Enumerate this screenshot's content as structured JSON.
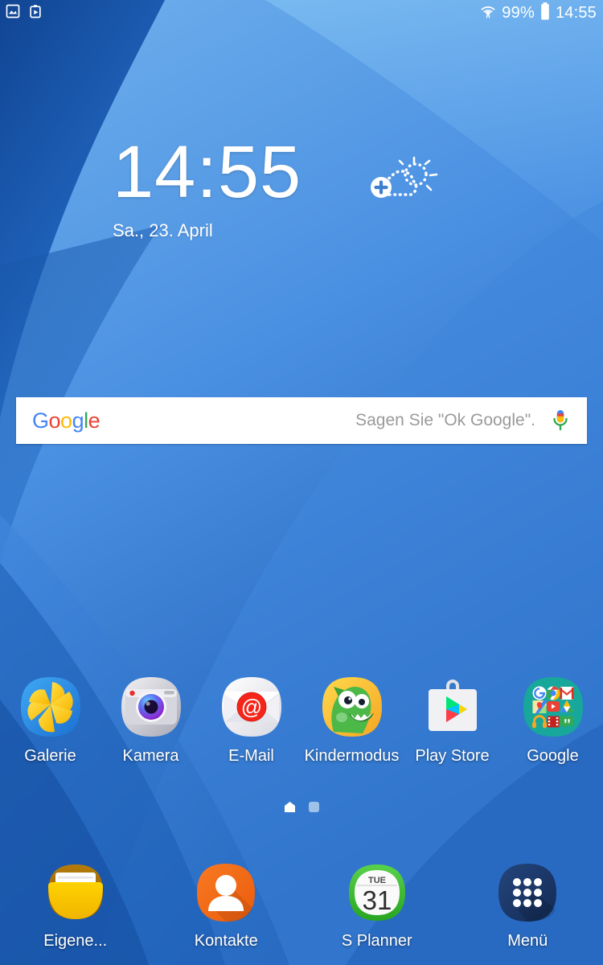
{
  "status_bar": {
    "left_icons": [
      {
        "name": "screenshot-icon",
        "label": "screenshot"
      },
      {
        "name": "media-clipboard-icon",
        "label": "smart-capture"
      }
    ],
    "wifi_icon": "wifi-icon",
    "battery_percent": "99%",
    "battery_icon": "battery-full-icon",
    "clock": "14:55"
  },
  "clock_widget": {
    "time": "14:55",
    "date": "Sa., 23. April",
    "weather_add_icon": "add-weather-icon"
  },
  "search": {
    "logo_letters": [
      "G",
      "o",
      "o",
      "g",
      "l",
      "e"
    ],
    "placeholder": "Sagen Sie \"Ok Google\".",
    "mic_icon": "microphone-icon"
  },
  "apps": [
    {
      "label": "Galerie",
      "icon": "gallery-icon"
    },
    {
      "label": "Kamera",
      "icon": "camera-icon"
    },
    {
      "label": "E-Mail",
      "icon": "email-icon"
    },
    {
      "label": "Kindermodus",
      "icon": "kids-mode-icon"
    },
    {
      "label": "Play Store",
      "icon": "play-store-icon"
    },
    {
      "label": "Google",
      "icon": "google-folder-icon"
    }
  ],
  "google_folder_apps": [
    "google-search-icon",
    "chrome-icon",
    "gmail-icon",
    "maps-icon",
    "youtube-icon",
    "drive-icon",
    "play-music-icon",
    "play-movies-icon",
    "hangouts-icon"
  ],
  "page_indicator": {
    "pages": 2,
    "current": 1,
    "home_icon": "home-page-indicator-icon"
  },
  "dock": [
    {
      "label": "Eigene...",
      "icon": "my-files-icon"
    },
    {
      "label": "Kontakte",
      "icon": "contacts-icon"
    },
    {
      "label": "S Planner",
      "icon": "calendar-icon",
      "day_name": "TUE",
      "day_number": "31"
    },
    {
      "label": "Menü",
      "icon": "apps-menu-icon"
    }
  ],
  "colors": {
    "wallpaper_light": "#6aa9e9",
    "wallpaper_mid": "#3b82d6",
    "wallpaper_dark": "#1453a8",
    "wallpaper_deep": "#0f3f8c",
    "search_bar_bg": "#ffffff",
    "google_blue": "#4285F4",
    "google_red": "#EA4335",
    "google_yellow": "#FBBC05",
    "google_green": "#34A853",
    "contacts_orange": "#F4661F",
    "menu_navy": "#1b3a6b",
    "folder_teal": "#1aa79a",
    "calendar_green": "#3cbf34"
  }
}
